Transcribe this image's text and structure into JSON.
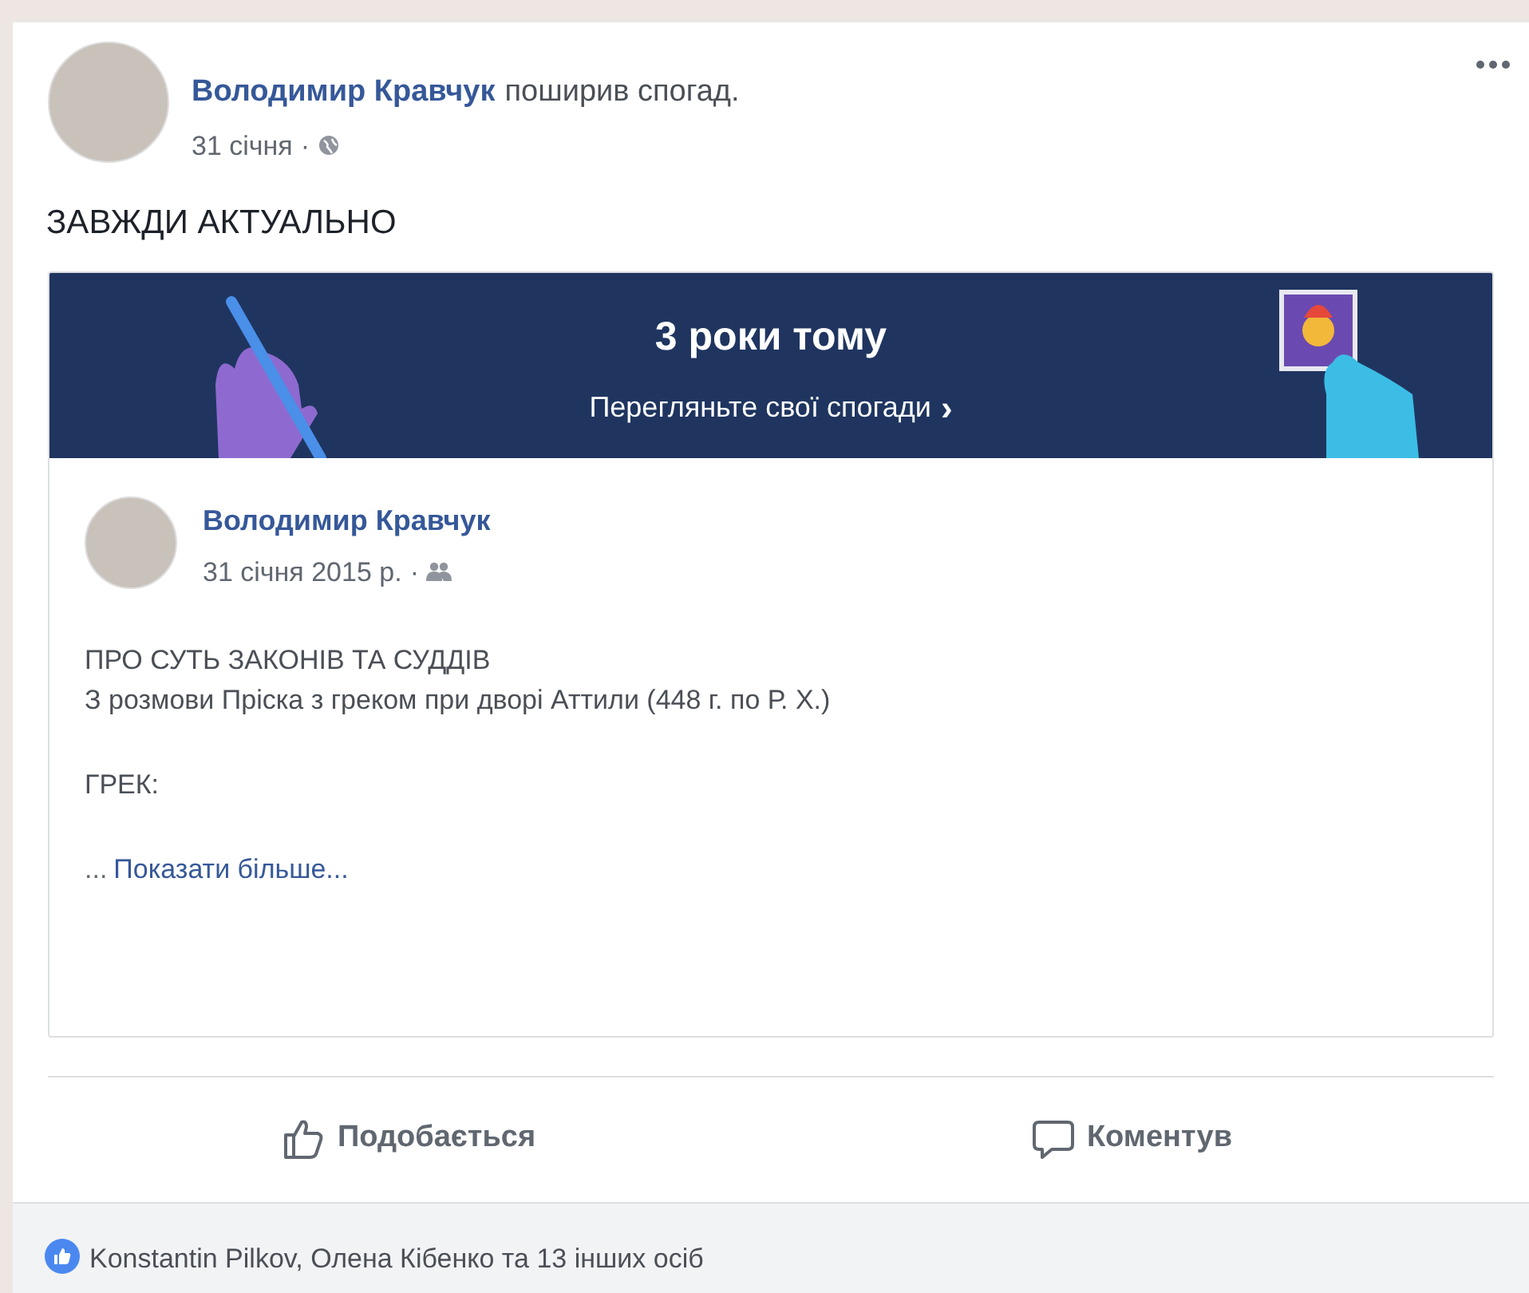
{
  "post": {
    "author": "Володимир Кравчук",
    "action": "поширив спогад.",
    "time": "31 січня",
    "separator": "·",
    "text": "ЗАВЖДИ АКТУАЛЬНО"
  },
  "memory_banner": {
    "title": "3 роки тому",
    "link": "Перегляньте свої спогади",
    "chevron": "›"
  },
  "shared_post": {
    "author": "Володимир Кравчук",
    "time": "31 січня 2015 р.",
    "separator": "·",
    "lines": [
      "ПРО СУТЬ ЗАКОНІВ ТА СУДДІВ",
      "З розмови Пріска з греком при дворі Аттили (448 г. по Р. Х.)"
    ],
    "paragraph_2": "ГРЕК:",
    "ellipsis": "...",
    "see_more": "Показати більше..."
  },
  "actions": [
    {
      "kind": "like",
      "label": "Подобається"
    },
    {
      "kind": "comment",
      "label": "Коментув"
    }
  ],
  "reactions": {
    "text": "Konstantin Pilkov, Олена Кібенко та 13 інших осіб"
  }
}
